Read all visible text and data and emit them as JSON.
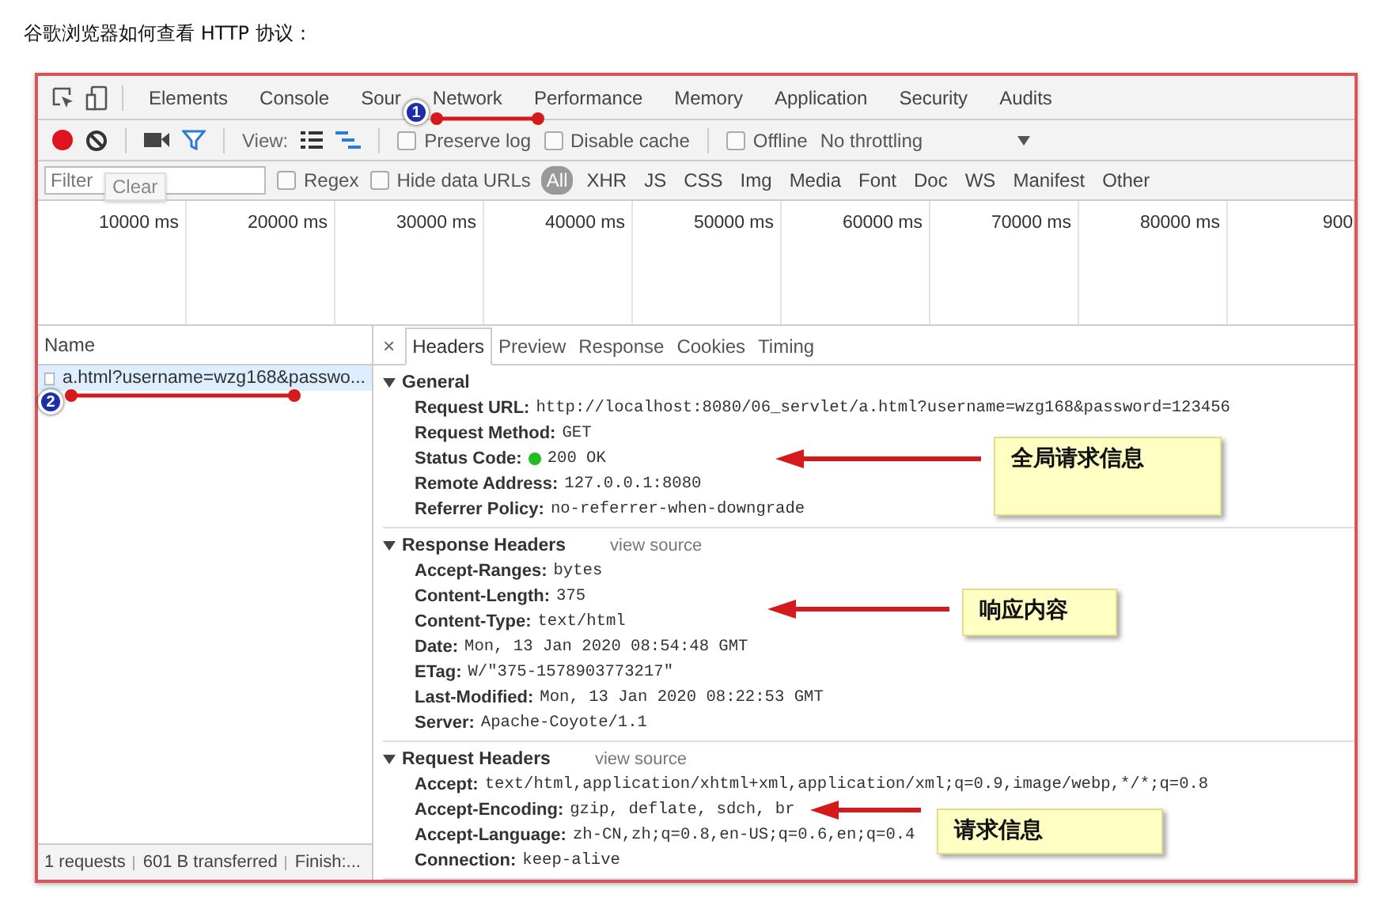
{
  "heading": "谷歌浏览器如何查看 HTTP 协议：",
  "devtools": {
    "panel_tabs": [
      "Elements",
      "Console",
      "Sour",
      "Network",
      "Performance",
      "Memory",
      "Application",
      "Security",
      "Audits"
    ],
    "toolbar": {
      "recording": true,
      "view_label": "View:",
      "options": [
        {
          "label": "Preserve log",
          "checked": false
        },
        {
          "label": "Disable cache",
          "checked": false
        }
      ],
      "offline": {
        "label": "Offline",
        "checked": false
      },
      "throttling": "No throttling"
    },
    "filter": {
      "placeholder": "Filter",
      "tooltip": "Clear",
      "options": [
        {
          "label": "Regex",
          "checked": false
        },
        {
          "label": "Hide data URLs",
          "checked": false
        }
      ],
      "types": [
        {
          "label": "All",
          "selected": true
        },
        {
          "label": "XHR",
          "selected": false
        },
        {
          "label": "JS",
          "selected": false
        },
        {
          "label": "CSS",
          "selected": false
        },
        {
          "label": "Img",
          "selected": false
        },
        {
          "label": "Media",
          "selected": false
        },
        {
          "label": "Font",
          "selected": false
        },
        {
          "label": "Doc",
          "selected": false
        },
        {
          "label": "WS",
          "selected": false
        },
        {
          "label": "Manifest",
          "selected": false
        },
        {
          "label": "Other",
          "selected": false
        }
      ]
    },
    "timeline_ticks": [
      "10000 ms",
      "20000 ms",
      "30000 ms",
      "40000 ms",
      "50000 ms",
      "60000 ms",
      "70000 ms",
      "80000 ms",
      "900"
    ],
    "requests": {
      "column": "Name",
      "rows": [
        {
          "name": "a.html?username=wzg168&passwo...",
          "selected": true
        }
      ],
      "status": [
        "1 requests",
        "601 B transferred",
        "Finish:..."
      ]
    },
    "detail": {
      "close": "×",
      "tabs": [
        {
          "label": "Headers",
          "selected": true
        },
        {
          "label": "Preview",
          "selected": false
        },
        {
          "label": "Response",
          "selected": false
        },
        {
          "label": "Cookies",
          "selected": false
        },
        {
          "label": "Timing",
          "selected": false
        }
      ],
      "sections": [
        {
          "title": "General",
          "expanded": true,
          "rows": [
            {
              "key": "Request URL:",
              "value": "http://localhost:8080/06_servlet/a.html?username=wzg168&password=123456"
            },
            {
              "key": "Request Method:",
              "value": "GET"
            },
            {
              "key": "Status Code:",
              "value": "200 OK",
              "kind": "status",
              "color": "#22bb22"
            },
            {
              "key": "Remote Address:",
              "value": "127.0.0.1:8080"
            },
            {
              "key": "Referrer Policy:",
              "value": "no-referrer-when-downgrade"
            }
          ]
        },
        {
          "title": "Response Headers",
          "expanded": true,
          "link": "view source",
          "rows": [
            {
              "key": "Accept-Ranges:",
              "value": "bytes"
            },
            {
              "key": "Content-Length:",
              "value": "375"
            },
            {
              "key": "Content-Type:",
              "value": "text/html"
            },
            {
              "key": "Date:",
              "value": "Mon, 13 Jan 2020 08:54:48 GMT"
            },
            {
              "key": "ETag:",
              "value": "W/\"375-1578903773217\""
            },
            {
              "key": "Last-Modified:",
              "value": "Mon, 13 Jan 2020 08:22:53 GMT"
            },
            {
              "key": "Server:",
              "value": "Apache-Coyote/1.1"
            }
          ]
        },
        {
          "title": "Request Headers",
          "expanded": true,
          "link": "view source",
          "rows": [
            {
              "key": "Accept:",
              "value": "text/html,application/xhtml+xml,application/xml;q=0.9,image/webp,*/*;q=0.8"
            },
            {
              "key": "Accept-Encoding:",
              "value": "gzip, deflate, sdch, br"
            },
            {
              "key": "Accept-Language:",
              "value": "zh-CN,zh;q=0.8,en-US;q=0.6,en;q=0.4"
            },
            {
              "key": "Connection:",
              "value": "keep-alive"
            }
          ]
        }
      ]
    }
  },
  "annotations": [
    {
      "kind": "badge",
      "label": "1"
    },
    {
      "kind": "badge",
      "label": "2"
    },
    {
      "kind": "note",
      "label": "全局请求信息"
    },
    {
      "kind": "note",
      "label": "响应内容"
    },
    {
      "kind": "note",
      "label": "请求信息"
    }
  ]
}
